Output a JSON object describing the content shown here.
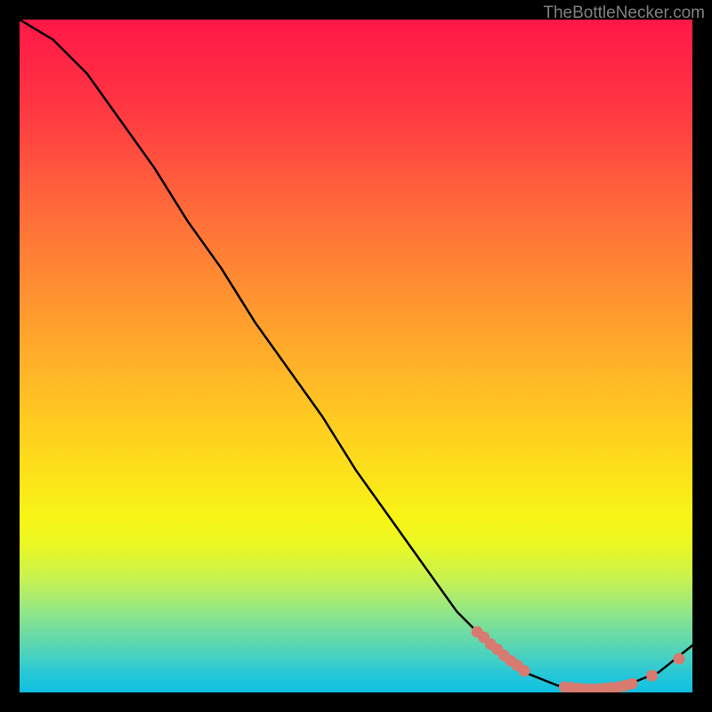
{
  "watermark": "TheBottleNecker.com",
  "chart_data": {
    "type": "line",
    "title": "",
    "xlabel": "",
    "ylabel": "",
    "xlim": [
      0,
      100
    ],
    "ylim": [
      0,
      100
    ],
    "curve": [
      {
        "x": 0,
        "y": 100
      },
      {
        "x": 5,
        "y": 97
      },
      {
        "x": 10,
        "y": 92
      },
      {
        "x": 15,
        "y": 85
      },
      {
        "x": 20,
        "y": 78
      },
      {
        "x": 25,
        "y": 70
      },
      {
        "x": 30,
        "y": 63
      },
      {
        "x": 35,
        "y": 55
      },
      {
        "x": 40,
        "y": 48
      },
      {
        "x": 45,
        "y": 41
      },
      {
        "x": 50,
        "y": 33
      },
      {
        "x": 55,
        "y": 26
      },
      {
        "x": 60,
        "y": 19
      },
      {
        "x": 65,
        "y": 12
      },
      {
        "x": 70,
        "y": 7
      },
      {
        "x": 75,
        "y": 3
      },
      {
        "x": 80,
        "y": 1
      },
      {
        "x": 85,
        "y": 0.5
      },
      {
        "x": 90,
        "y": 1
      },
      {
        "x": 95,
        "y": 3
      },
      {
        "x": 100,
        "y": 7
      }
    ],
    "highlighted_points": [
      {
        "x": 68,
        "y": 9.0
      },
      {
        "x": 69,
        "y": 8.2
      },
      {
        "x": 70,
        "y": 7.2
      },
      {
        "x": 71,
        "y": 6.4
      },
      {
        "x": 72,
        "y": 5.5
      },
      {
        "x": 73,
        "y": 4.7
      },
      {
        "x": 74,
        "y": 4.0
      },
      {
        "x": 75,
        "y": 3.2
      },
      {
        "x": 81,
        "y": 0.8
      },
      {
        "x": 82,
        "y": 0.7
      },
      {
        "x": 83,
        "y": 0.6
      },
      {
        "x": 84,
        "y": 0.5
      },
      {
        "x": 85,
        "y": 0.5
      },
      {
        "x": 86,
        "y": 0.5
      },
      {
        "x": 87,
        "y": 0.6
      },
      {
        "x": 88,
        "y": 0.7
      },
      {
        "x": 89,
        "y": 0.8
      },
      {
        "x": 90,
        "y": 1.0
      },
      {
        "x": 91,
        "y": 1.3
      },
      {
        "x": 94,
        "y": 2.5
      },
      {
        "x": 98,
        "y": 5.0
      }
    ],
    "series": [
      {
        "name": "bottleneck-curve",
        "color": "#000000"
      },
      {
        "name": "highlighted-zone",
        "color": "#d87a6f"
      }
    ]
  }
}
